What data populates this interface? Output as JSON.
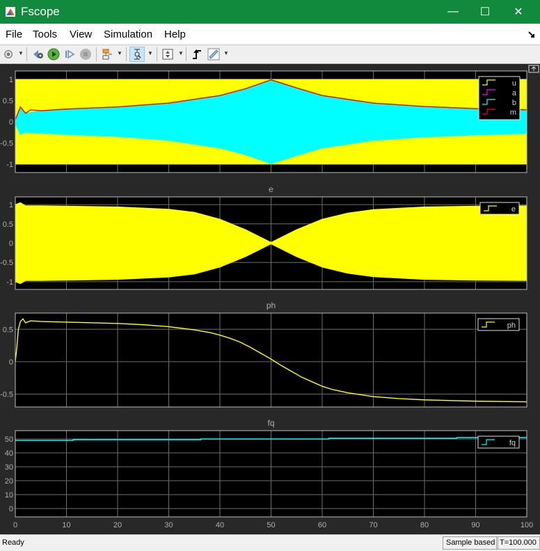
{
  "window": {
    "title": "Fscope",
    "minimize": "—",
    "maximize": "☐",
    "close": "✕"
  },
  "menu": [
    "File",
    "Tools",
    "View",
    "Simulation",
    "Help"
  ],
  "toolbar": [
    {
      "name": "configuration-properties",
      "icon": "gear-icon",
      "dropdown": true
    },
    {
      "name": "step-back",
      "icon": "step-back-icon"
    },
    {
      "name": "run",
      "icon": "play-icon"
    },
    {
      "name": "step-forward",
      "icon": "step-forward-icon"
    },
    {
      "name": "stop",
      "icon": "stop-icon"
    },
    {
      "name": "highlight-block",
      "icon": "highlight-block-icon",
      "dropdown": true
    },
    {
      "name": "zoom",
      "icon": "zoom-icon",
      "dropdown": true,
      "active": true
    },
    {
      "name": "autoscale",
      "icon": "autoscale-icon",
      "dropdown": true
    },
    {
      "name": "triggers",
      "icon": "trigger-icon"
    },
    {
      "name": "measurements",
      "icon": "ruler-icon",
      "dropdown": true
    }
  ],
  "status": {
    "left": "Ready",
    "mode": "Sample based",
    "time": "T=100.000"
  },
  "colors": {
    "titlebar": "#118a3d",
    "plot_bg": "#000000",
    "figure_bg": "#282828",
    "grid": "#6e6e6e",
    "axis_text": "#aeaeae",
    "yellow": "#ffff00",
    "magenta": "#ff00ff",
    "cyan": "#00ffff",
    "red": "#ff0000"
  },
  "chart_data": [
    {
      "type": "area",
      "title": "",
      "xlabel": "",
      "ylabel": "",
      "xlim": [
        0,
        100
      ],
      "ylim": [
        -1.2,
        1.2
      ],
      "yticks": [
        1,
        0.5,
        0,
        -0.5,
        -1
      ],
      "xticks": [
        0,
        10,
        20,
        30,
        40,
        50,
        60,
        70,
        80,
        90,
        100
      ],
      "grid": true,
      "legend": "top-right",
      "legend_entries": [
        "u",
        "a",
        "b",
        "m"
      ],
      "series": [
        {
          "name": "u",
          "color": "#ffff00",
          "description": "oscillation envelope",
          "x": [
            0,
            100
          ],
          "upper": [
            1,
            1
          ],
          "lower": [
            -1,
            -1
          ]
        },
        {
          "name": "a",
          "color": "#ff00ff",
          "x": [
            0,
            0.5
          ],
          "values": [
            0,
            -0.1
          ]
        },
        {
          "name": "b",
          "color": "#00ffff",
          "description": "oscillation envelope",
          "x": [
            0,
            1,
            2,
            5,
            10,
            20,
            30,
            40,
            45,
            50,
            55,
            60,
            70,
            80,
            90,
            100
          ],
          "upper": [
            0.05,
            0.35,
            0.2,
            0.26,
            0.3,
            0.35,
            0.44,
            0.62,
            0.78,
            0.99,
            0.8,
            0.62,
            0.44,
            0.36,
            0.31,
            0.28
          ],
          "lower": [
            -0.05,
            -0.3,
            -0.25,
            -0.27,
            -0.3,
            -0.35,
            -0.44,
            -0.62,
            -0.78,
            -0.99,
            -0.8,
            -0.62,
            -0.44,
            -0.36,
            -0.31,
            -0.28
          ]
        },
        {
          "name": "m",
          "color": "#ff0000",
          "x": [
            0,
            1,
            2,
            3,
            5,
            10,
            20,
            30,
            40,
            45,
            50,
            55,
            60,
            70,
            80,
            90,
            100
          ],
          "values": [
            0.05,
            0.35,
            0.2,
            0.28,
            0.26,
            0.3,
            0.35,
            0.44,
            0.62,
            0.78,
            0.99,
            0.8,
            0.62,
            0.44,
            0.36,
            0.31,
            0.28
          ]
        }
      ]
    },
    {
      "type": "area",
      "title": "e",
      "xlabel": "",
      "ylabel": "",
      "xlim": [
        0,
        100
      ],
      "ylim": [
        -1.2,
        1.2
      ],
      "yticks": [
        1,
        0.5,
        0,
        -0.5,
        -1
      ],
      "xticks": [
        0,
        10,
        20,
        30,
        40,
        50,
        60,
        70,
        80,
        90,
        100
      ],
      "grid": true,
      "legend": "top-right",
      "legend_entries": [
        "e"
      ],
      "series": [
        {
          "name": "e",
          "color": "#ffff00",
          "description": "oscillation envelope",
          "x": [
            0,
            1,
            2,
            5,
            10,
            20,
            30,
            35,
            40,
            45,
            50,
            55,
            60,
            65,
            70,
            80,
            90,
            100
          ],
          "upper": [
            1.0,
            1.05,
            0.97,
            0.97,
            0.96,
            0.94,
            0.88,
            0.8,
            0.62,
            0.35,
            0.02,
            0.35,
            0.62,
            0.78,
            0.87,
            0.94,
            0.96,
            0.97
          ],
          "lower": [
            -1.0,
            -1.05,
            -0.97,
            -0.97,
            -0.96,
            -0.94,
            -0.88,
            -0.8,
            -0.62,
            -0.35,
            -0.02,
            -0.35,
            -0.62,
            -0.78,
            -0.87,
            -0.94,
            -0.96,
            -0.97
          ]
        }
      ]
    },
    {
      "type": "line",
      "title": "ph",
      "xlabel": "",
      "ylabel": "",
      "xlim": [
        0,
        100
      ],
      "ylim": [
        -0.7,
        0.75
      ],
      "yticks": [
        0.5,
        0,
        -0.5
      ],
      "xticks": [
        0,
        10,
        20,
        30,
        40,
        50,
        60,
        70,
        80,
        90,
        100
      ],
      "grid": true,
      "legend": "top-right",
      "legend_entries": [
        "ph"
      ],
      "series": [
        {
          "name": "ph",
          "color": "#ffff00",
          "x": [
            0,
            0.3,
            0.6,
            1,
            1.5,
            2,
            3,
            5,
            10,
            20,
            25,
            30,
            35,
            38,
            40,
            42,
            44,
            46,
            48,
            50,
            52,
            54,
            56,
            58,
            60,
            62,
            65,
            70,
            75,
            80,
            90,
            100
          ],
          "values": [
            0,
            0.22,
            0.5,
            0.62,
            0.66,
            0.6,
            0.63,
            0.62,
            0.61,
            0.59,
            0.57,
            0.54,
            0.49,
            0.45,
            0.41,
            0.36,
            0.3,
            0.22,
            0.13,
            0.04,
            -0.06,
            -0.15,
            -0.24,
            -0.31,
            -0.38,
            -0.43,
            -0.48,
            -0.54,
            -0.57,
            -0.59,
            -0.61,
            -0.62
          ]
        }
      ]
    },
    {
      "type": "line",
      "title": "fq",
      "xlabel": "",
      "ylabel": "",
      "xlim": [
        0,
        100
      ],
      "ylim": [
        -6,
        56
      ],
      "yticks": [
        50,
        40,
        30,
        20,
        10,
        0
      ],
      "xticks": [
        0,
        10,
        20,
        30,
        40,
        50,
        60,
        70,
        80,
        90,
        100
      ],
      "xticklabels": [
        "0",
        "10",
        "20",
        "30",
        "40",
        "50",
        "60",
        "70",
        "80",
        "90",
        "100"
      ],
      "grid": true,
      "legend": "top-right",
      "legend_entries": [
        "fq"
      ],
      "series": [
        {
          "name": "fq",
          "color": "#00ffff",
          "step": true,
          "x": [
            0,
            11.3,
            11.3,
            36.3,
            36.3,
            61.3,
            61.3,
            86.3,
            86.3,
            100
          ],
          "values": [
            49.0,
            49.0,
            49.5,
            49.5,
            50.0,
            50.0,
            50.5,
            50.5,
            51.0,
            51.0
          ]
        }
      ]
    }
  ]
}
